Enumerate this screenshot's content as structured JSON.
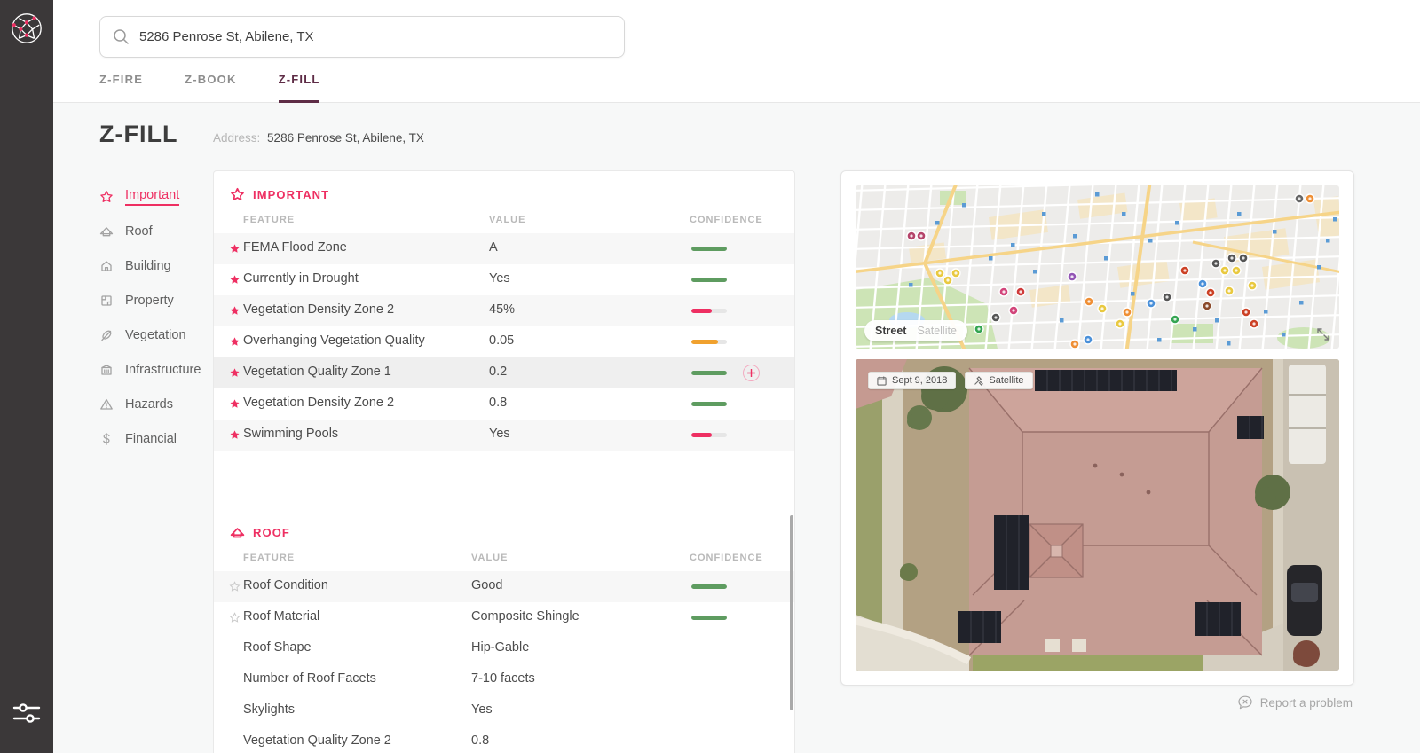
{
  "header": {
    "search": {
      "value": "5286 Penrose St, Abilene, TX"
    }
  },
  "tabs": [
    {
      "label": "Z-FIRE",
      "active": false
    },
    {
      "label": "Z-BOOK",
      "active": false
    },
    {
      "label": "Z-FILL",
      "active": true
    }
  ],
  "page": {
    "title": "Z-FILL",
    "address_label": "Address:",
    "address": "5286 Penrose St, Abilene, TX"
  },
  "nav": {
    "items": [
      {
        "label": "Important",
        "icon": "star",
        "active": true
      },
      {
        "label": "Roof",
        "icon": "roof",
        "active": false
      },
      {
        "label": "Building",
        "icon": "building",
        "active": false
      },
      {
        "label": "Property",
        "icon": "property",
        "active": false
      },
      {
        "label": "Vegetation",
        "icon": "vegetation",
        "active": false
      },
      {
        "label": "Infrastructure",
        "icon": "infrastructure",
        "active": false
      },
      {
        "label": "Hazards",
        "icon": "hazards",
        "active": false
      },
      {
        "label": "Financial",
        "icon": "financial",
        "active": false
      }
    ]
  },
  "sections": [
    {
      "title": "IMPORTANT",
      "icon": "star",
      "columns": [
        "FEATURE",
        "VALUE",
        "CONFIDENCE"
      ],
      "rows": [
        {
          "feature": "FEMA Flood Zone",
          "value": "A",
          "star": "filled",
          "shaded": true,
          "confidence": {
            "pct": 100,
            "color": "#5e9c60"
          }
        },
        {
          "feature": "Currently in Drought",
          "value": "Yes",
          "star": "filled",
          "confidence": {
            "pct": 100,
            "color": "#5e9c60"
          }
        },
        {
          "feature": "Vegetation Density Zone 2",
          "value": "45%",
          "star": "filled",
          "shaded": true,
          "confidence": {
            "pct": 58,
            "color": "#ee2f62"
          }
        },
        {
          "feature": "Overhanging Vegetation Quality",
          "value": "0.05",
          "star": "filled",
          "confidence": {
            "pct": 75,
            "color": "#f0a12e"
          }
        },
        {
          "feature": "Vegetation Quality Zone 1",
          "value": "0.2",
          "star": "filled",
          "shaded": true,
          "highlighted": true,
          "add_button": true,
          "confidence": {
            "pct": 100,
            "color": "#5e9c60"
          }
        },
        {
          "feature": "Vegetation Density Zone 2",
          "value": "0.8",
          "star": "filled",
          "confidence": {
            "pct": 100,
            "color": "#5e9c60"
          }
        },
        {
          "feature": "Swimming Pools",
          "value": "Yes",
          "star": "filled",
          "shaded": true,
          "confidence": {
            "pct": 58,
            "color": "#ee2f62"
          }
        }
      ]
    },
    {
      "title": "ROOF",
      "icon": "roof",
      "columns": [
        "FEATURE",
        "VALUE",
        "CONFIDENCE"
      ],
      "rows": [
        {
          "feature": "Roof Condition",
          "value": "Good",
          "star": "outline",
          "shaded": true,
          "confidence": {
            "pct": 100,
            "color": "#5e9c60"
          }
        },
        {
          "feature": "Roof Material",
          "value": "Composite Shingle",
          "star": "outline",
          "confidence": {
            "pct": 100,
            "color": "#5e9c60"
          }
        },
        {
          "feature": "Roof Shape",
          "value": "Hip-Gable"
        },
        {
          "feature": "Number of Roof Facets",
          "value": "7-10 facets"
        },
        {
          "feature": "Skylights",
          "value": "Yes"
        },
        {
          "feature": "Vegetation Quality Zone 2",
          "value": "0.8"
        }
      ]
    }
  ],
  "map_panel": {
    "street_map": {
      "street_label": "Street",
      "satellite_label": "Satellite",
      "active": "Street"
    },
    "satellite_view": {
      "date_badge": "Sept 9, 2018",
      "type_badge": "Satellite"
    }
  },
  "footer": {
    "report_label": "Report a problem"
  },
  "colors": {
    "accent": "#ee2f62",
    "tab_active": "#5e2c46",
    "confidence_green": "#5e9c60",
    "confidence_orange": "#f0a12e",
    "confidence_pink": "#ee2f62"
  }
}
